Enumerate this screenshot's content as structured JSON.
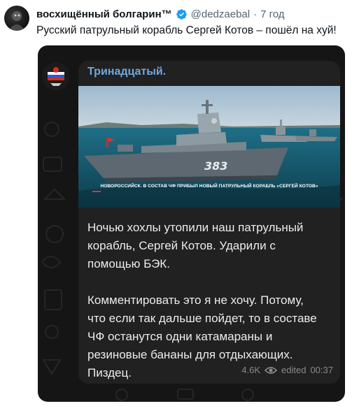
{
  "tweet": {
    "author_name": "восхищённый болгарин™",
    "handle": "@dedzaebal",
    "separator": "·",
    "time": "7 год",
    "text": "Русский патрульный корабль Сергей Котов – пошёл на хуй!"
  },
  "telegram": {
    "channel_name": "Тринадцатый.",
    "photo": {
      "hull_number": "383",
      "caption": "НОВОРОССИЙСК. В СОСТАВ ЧФ ПРИБЫЛ НОВЫЙ ПАТРУЛЬНЫЙ КОРАБЛЬ «СЕРГЕЙ КОТОВ»"
    },
    "message_lines": [
      "Ночью хохлы утопили наш патрульный",
      "корабль, Сергей Котов. Ударили с",
      "помощью БЭК.",
      "",
      "Комментировать это я не хочу. Потому,",
      "что если так дальше пойдет, то в составе",
      "ЧФ останутся одни катамараны и",
      "резиновые бананы для отдыхающих.",
      "Пиздец."
    ],
    "views": "4.6K",
    "edited_label": "edited",
    "post_time": "00:37"
  },
  "colors": {
    "verified_badge": "#1d9bf0",
    "channel_name": "#6fa8dc",
    "bubble": "#212121",
    "chat_background": "#151515"
  }
}
